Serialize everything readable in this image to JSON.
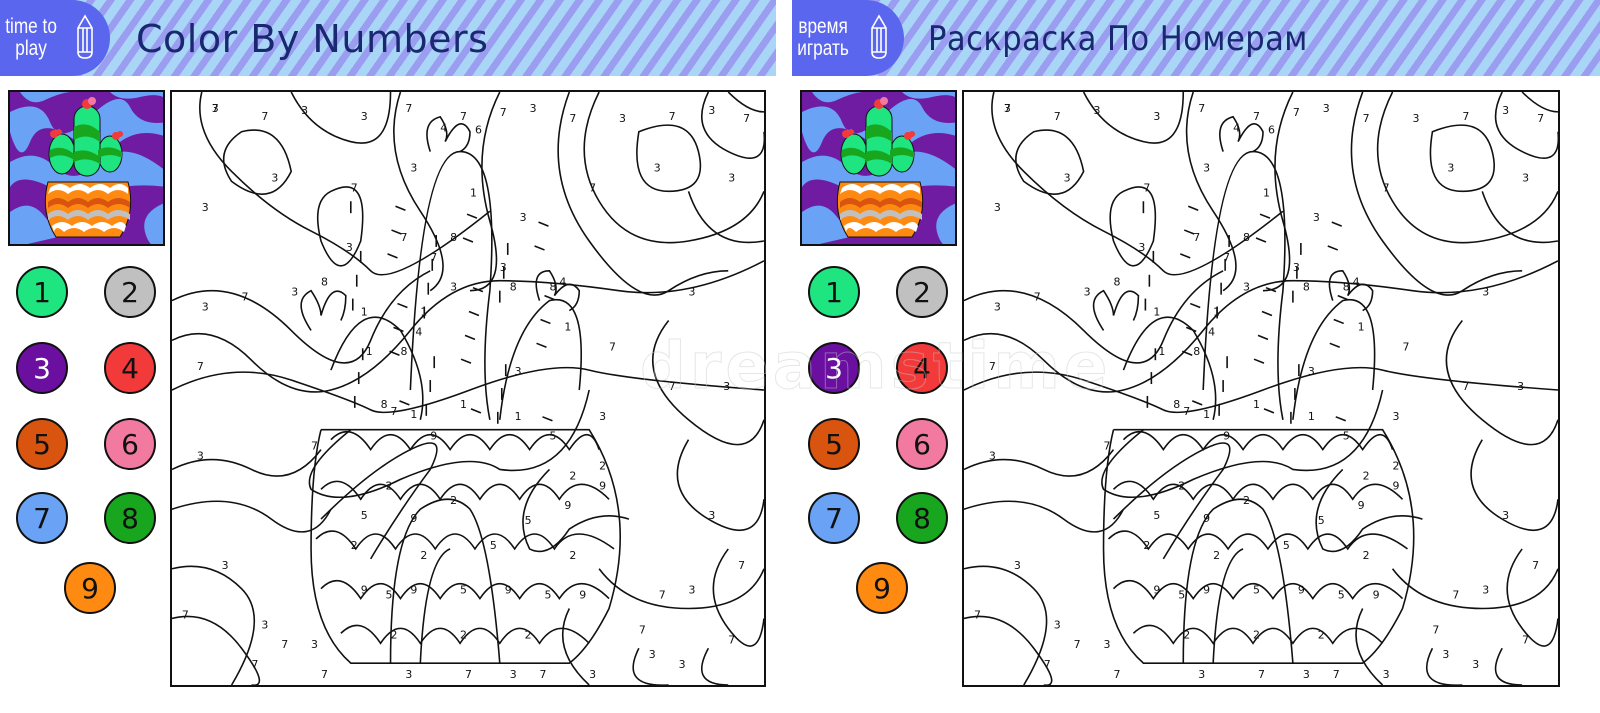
{
  "panels": [
    {
      "lang": "en",
      "badge_text": [
        "time to",
        "play"
      ],
      "title": "Color By Numbers"
    },
    {
      "lang": "ru",
      "badge_text": [
        "время",
        "играть"
      ],
      "title": "Раскраска По Номерам"
    }
  ],
  "palette": [
    {
      "number": "1",
      "color": "#1ee57f",
      "text_color": "#111111"
    },
    {
      "number": "2",
      "color": "#c0c0c0",
      "text_color": "#111111"
    },
    {
      "number": "3",
      "color": "#6a0fa0",
      "text_color": "#ffffff"
    },
    {
      "number": "4",
      "color": "#f23a3a",
      "text_color": "#111111"
    },
    {
      "number": "5",
      "color": "#d8540f",
      "text_color": "#111111"
    },
    {
      "number": "6",
      "color": "#f27aa0",
      "text_color": "#111111"
    },
    {
      "number": "7",
      "color": "#6aa3f5",
      "text_color": "#111111"
    },
    {
      "number": "8",
      "color": "#19a61f",
      "text_color": "#111111"
    },
    {
      "number": "9",
      "color": "#ff8a12",
      "text_color": "#111111"
    }
  ],
  "preview": {
    "subject": "cactus-in-patterned-pot",
    "colors": {
      "background_dark": "#6f1ca3",
      "background_light": "#6aa3f5",
      "cactus_light": "#1ee57f",
      "cactus_dark": "#19a61f",
      "flower": "#f23a3a",
      "flower_tip": "#f27aa0",
      "pot_orange": "#ff8a12",
      "pot_dark_orange": "#d8540f",
      "pot_gray": "#c0c0c0",
      "pot_white": "#ffffff"
    }
  },
  "canvas_labels": [
    {
      "n": "3"
    },
    {
      "n": "7"
    },
    {
      "n": "3"
    },
    {
      "n": "3"
    },
    {
      "n": "7"
    },
    {
      "n": "7"
    },
    {
      "n": "7"
    },
    {
      "n": "3"
    },
    {
      "n": "7"
    },
    {
      "n": "3"
    },
    {
      "n": "7"
    },
    {
      "n": "3"
    },
    {
      "n": "7"
    },
    {
      "n": "3"
    },
    {
      "n": "3"
    },
    {
      "n": "7"
    },
    {
      "n": "4"
    },
    {
      "n": "6"
    },
    {
      "n": "3"
    },
    {
      "n": "1"
    },
    {
      "n": "8"
    },
    {
      "n": "7"
    },
    {
      "n": "3"
    },
    {
      "n": "7"
    },
    {
      "n": "3"
    },
    {
      "n": "3"
    },
    {
      "n": "3"
    },
    {
      "n": "7"
    },
    {
      "n": "3"
    },
    {
      "n": "3"
    },
    {
      "n": "7"
    },
    {
      "n": "3"
    },
    {
      "n": "4"
    },
    {
      "n": "8"
    },
    {
      "n": "1"
    },
    {
      "n": "1"
    },
    {
      "n": "8"
    },
    {
      "n": "1"
    },
    {
      "n": "3"
    },
    {
      "n": "8"
    },
    {
      "n": "4"
    },
    {
      "n": "8"
    },
    {
      "n": "1"
    },
    {
      "n": "3"
    },
    {
      "n": "7"
    },
    {
      "n": "3"
    },
    {
      "n": "7"
    },
    {
      "n": "3"
    },
    {
      "n": "7"
    },
    {
      "n": "8"
    },
    {
      "n": "1"
    },
    {
      "n": "7"
    },
    {
      "n": "1"
    },
    {
      "n": "1"
    },
    {
      "n": "3"
    },
    {
      "n": "3"
    },
    {
      "n": "9"
    },
    {
      "n": "5"
    },
    {
      "n": "2"
    },
    {
      "n": "7"
    },
    {
      "n": "2"
    },
    {
      "n": "2"
    },
    {
      "n": "5"
    },
    {
      "n": "9"
    },
    {
      "n": "5"
    },
    {
      "n": "9"
    },
    {
      "n": "2"
    },
    {
      "n": "9"
    },
    {
      "n": "5"
    },
    {
      "n": "2"
    },
    {
      "n": "2"
    },
    {
      "n": "2"
    },
    {
      "n": "9"
    },
    {
      "n": "5"
    },
    {
      "n": "9"
    },
    {
      "n": "5"
    },
    {
      "n": "9"
    },
    {
      "n": "5"
    },
    {
      "n": "9"
    },
    {
      "n": "2"
    },
    {
      "n": "2"
    },
    {
      "n": "2"
    },
    {
      "n": "3"
    },
    {
      "n": "7"
    },
    {
      "n": "3"
    },
    {
      "n": "7"
    },
    {
      "n": "3"
    },
    {
      "n": "7"
    },
    {
      "n": "3"
    },
    {
      "n": "7"
    },
    {
      "n": "3"
    },
    {
      "n": "7"
    },
    {
      "n": "3"
    },
    {
      "n": "7"
    },
    {
      "n": "3"
    },
    {
      "n": "7"
    },
    {
      "n": "7"
    },
    {
      "n": "3"
    },
    {
      "n": "7"
    },
    {
      "n": "3"
    },
    {
      "n": "7"
    },
    {
      "n": "3"
    },
    {
      "n": "7"
    }
  ],
  "watermark": "dreamstime"
}
